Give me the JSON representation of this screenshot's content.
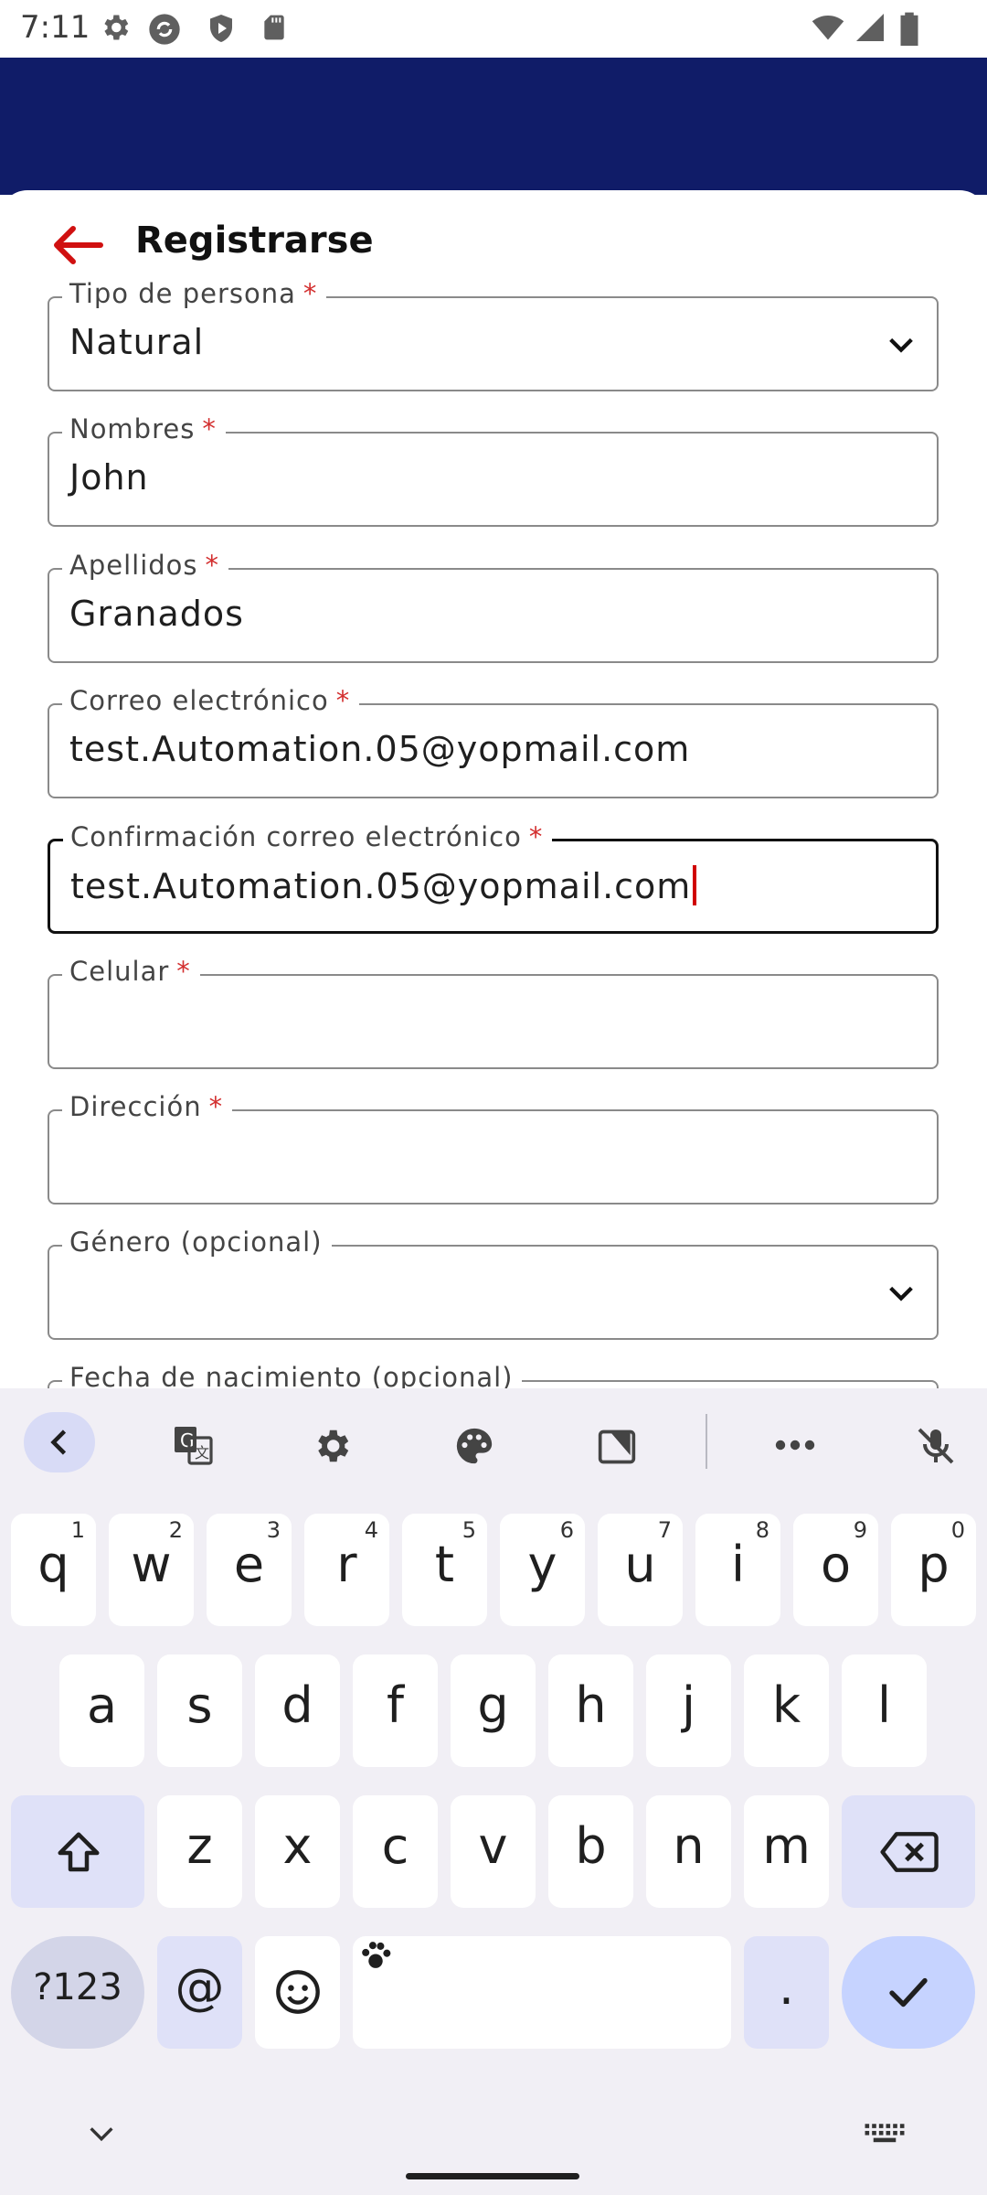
{
  "status_bar": {
    "time": "7:11"
  },
  "header": {
    "title": "Registrarse"
  },
  "form": {
    "person_type": {
      "label": "Tipo de persona",
      "required_mark": "*",
      "value": "Natural"
    },
    "first_names": {
      "label": "Nombres",
      "required_mark": "*",
      "value": "John"
    },
    "last_names": {
      "label": "Apellidos",
      "required_mark": "*",
      "value": "Granados"
    },
    "email": {
      "label": "Correo electrónico",
      "required_mark": "*",
      "value": "test.Automation.05@yopmail.com"
    },
    "email_confirm": {
      "label": "Confirmación correo electrónico",
      "required_mark": "*",
      "value": "test.Automation.05@yopmail.com"
    },
    "mobile": {
      "label": "Celular",
      "required_mark": "*",
      "value": ""
    },
    "address": {
      "label": "Dirección",
      "required_mark": "*",
      "value": ""
    },
    "gender": {
      "label": "Género (opcional)",
      "value": ""
    },
    "birth_date": {
      "label": "Fecha de nacimiento (opcional)"
    }
  },
  "keyboard": {
    "row1": [
      {
        "key": "q",
        "hint": "1"
      },
      {
        "key": "w",
        "hint": "2"
      },
      {
        "key": "e",
        "hint": "3"
      },
      {
        "key": "r",
        "hint": "4"
      },
      {
        "key": "t",
        "hint": "5"
      },
      {
        "key": "y",
        "hint": "6"
      },
      {
        "key": "u",
        "hint": "7"
      },
      {
        "key": "i",
        "hint": "8"
      },
      {
        "key": "o",
        "hint": "9"
      },
      {
        "key": "p",
        "hint": "0"
      }
    ],
    "row2": [
      "a",
      "s",
      "d",
      "f",
      "g",
      "h",
      "j",
      "k",
      "l"
    ],
    "row3": [
      "z",
      "x",
      "c",
      "v",
      "b",
      "n",
      "m"
    ],
    "symbols_label": "?123",
    "at_label": "@",
    "period_label": ".",
    "colors": {
      "accent": "#101c68",
      "error": "#d32f2f",
      "modifier_key": "#dfe1f8",
      "action_key": "#c6d3ff"
    }
  }
}
